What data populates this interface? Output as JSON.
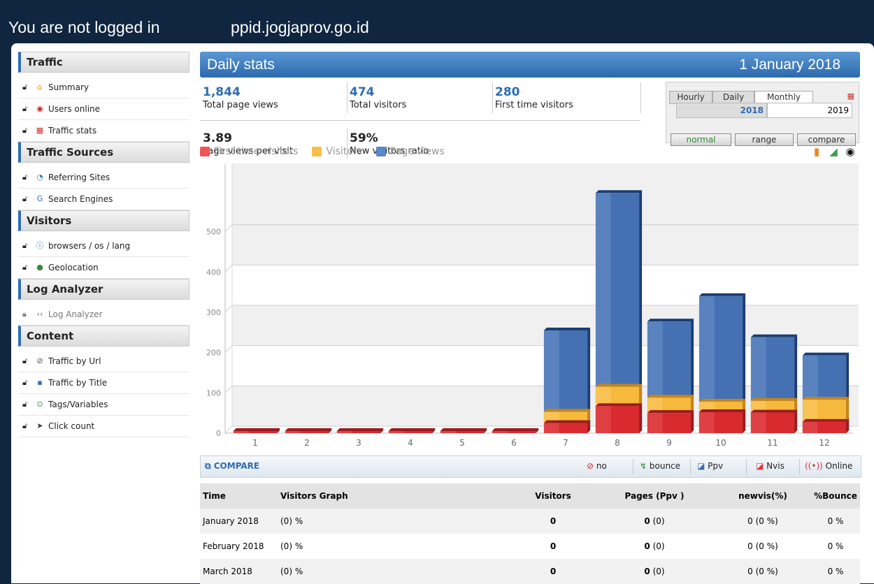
{
  "header": {
    "login_status": "You are not logged in",
    "site": "ppid.jogjaprov.go.id"
  },
  "sidebar": {
    "sections": [
      {
        "title": "Traffic",
        "items": [
          {
            "label": "Summary",
            "icon": "home-icon"
          },
          {
            "label": "Users online",
            "icon": "live-icon"
          },
          {
            "label": "Traffic stats",
            "icon": "calendar-icon"
          }
        ]
      },
      {
        "title": "Traffic Sources",
        "items": [
          {
            "label": "Referring Sites",
            "icon": "globe-icon"
          },
          {
            "label": "Search Engines",
            "icon": "google-icon"
          }
        ]
      },
      {
        "title": "Visitors",
        "items": [
          {
            "label": "browsers / os / lang",
            "icon": "info-icon"
          },
          {
            "label": "Geolocation",
            "icon": "earth-icon"
          }
        ]
      },
      {
        "title": "Log Analyzer",
        "items": [
          {
            "label": "Log Analyzer",
            "icon": "code-icon"
          }
        ]
      },
      {
        "title": "Content",
        "items": [
          {
            "label": "Traffic by Url",
            "icon": "link-icon"
          },
          {
            "label": "Traffic by Title",
            "icon": "title-icon"
          },
          {
            "label": "Tags/Variables",
            "icon": "tag-icon"
          },
          {
            "label": "Click count",
            "icon": "cursor-icon"
          }
        ]
      }
    ]
  },
  "main": {
    "title": "Daily stats",
    "date": "1 January 2018",
    "stats": {
      "page_views": {
        "value": "1,844",
        "label": "Total page views"
      },
      "visitors": {
        "value": "474",
        "label": "Total visitors"
      },
      "first_time": {
        "value": "280",
        "label": "First time visitors"
      },
      "ppv": {
        "value": "3.89",
        "label": "Page views per visit"
      },
      "new_ratio": {
        "value": "59%",
        "label": "New visitors ratio"
      }
    },
    "period": {
      "tabs": [
        "Hourly",
        "Daily",
        "Monthly"
      ],
      "active_tab": "Monthly",
      "years": [
        "2018",
        "2019"
      ],
      "modes": [
        "normal",
        "range",
        "compare"
      ]
    },
    "legend": [
      "First time visitors",
      "Visitors",
      "Page views"
    ],
    "compare": {
      "label": "COMPARE",
      "options": [
        "no",
        "bounce",
        "Ppv",
        "Nvis",
        "Online"
      ]
    },
    "table": {
      "headers": [
        "Time",
        "Visitors Graph",
        "Visitors",
        "Pages (Ppv )",
        "newvis(%)",
        "%Bounce"
      ],
      "rows": [
        {
          "time": "January 2018",
          "graph": "(0) %",
          "visitors": "0",
          "pages": "0",
          "ppv": "(0)",
          "newvis": "0 (0 %)",
          "bounce": "0 %"
        },
        {
          "time": "February 2018",
          "graph": "(0) %",
          "visitors": "0",
          "pages": "0",
          "ppv": "(0)",
          "newvis": "0 (0 %)",
          "bounce": "0 %"
        },
        {
          "time": "March 2018",
          "graph": "(0) %",
          "visitors": "0",
          "pages": "0",
          "ppv": "(0)",
          "newvis": "0 (0 %)",
          "bounce": "0 %"
        }
      ]
    }
  },
  "colors": {
    "first_time": "#e8383a",
    "visitors": "#f6b93b",
    "page_views": "#3d6cae",
    "accent": "#2e6db4"
  },
  "chart_data": {
    "type": "bar",
    "categories": [
      "1",
      "2",
      "3",
      "4",
      "5",
      "6",
      "7",
      "8",
      "9",
      "10",
      "11",
      "12"
    ],
    "series": [
      {
        "name": "First time visitors",
        "values": [
          0,
          0,
          0,
          0,
          0,
          0,
          25,
          67,
          50,
          52,
          51,
          28
        ]
      },
      {
        "name": "Visitors",
        "values": [
          0,
          0,
          0,
          0,
          0,
          0,
          53,
          115,
          88,
          78,
          80,
          83
        ]
      },
      {
        "name": "Page views",
        "values": [
          0,
          0,
          0,
          0,
          0,
          0,
          255,
          596,
          277,
          340,
          238,
          193
        ]
      }
    ],
    "ylim": [
      0,
      600
    ],
    "yticks": [
      0,
      100,
      200,
      300,
      400,
      500
    ],
    "xlabel": "",
    "ylabel": "",
    "grid": true
  }
}
